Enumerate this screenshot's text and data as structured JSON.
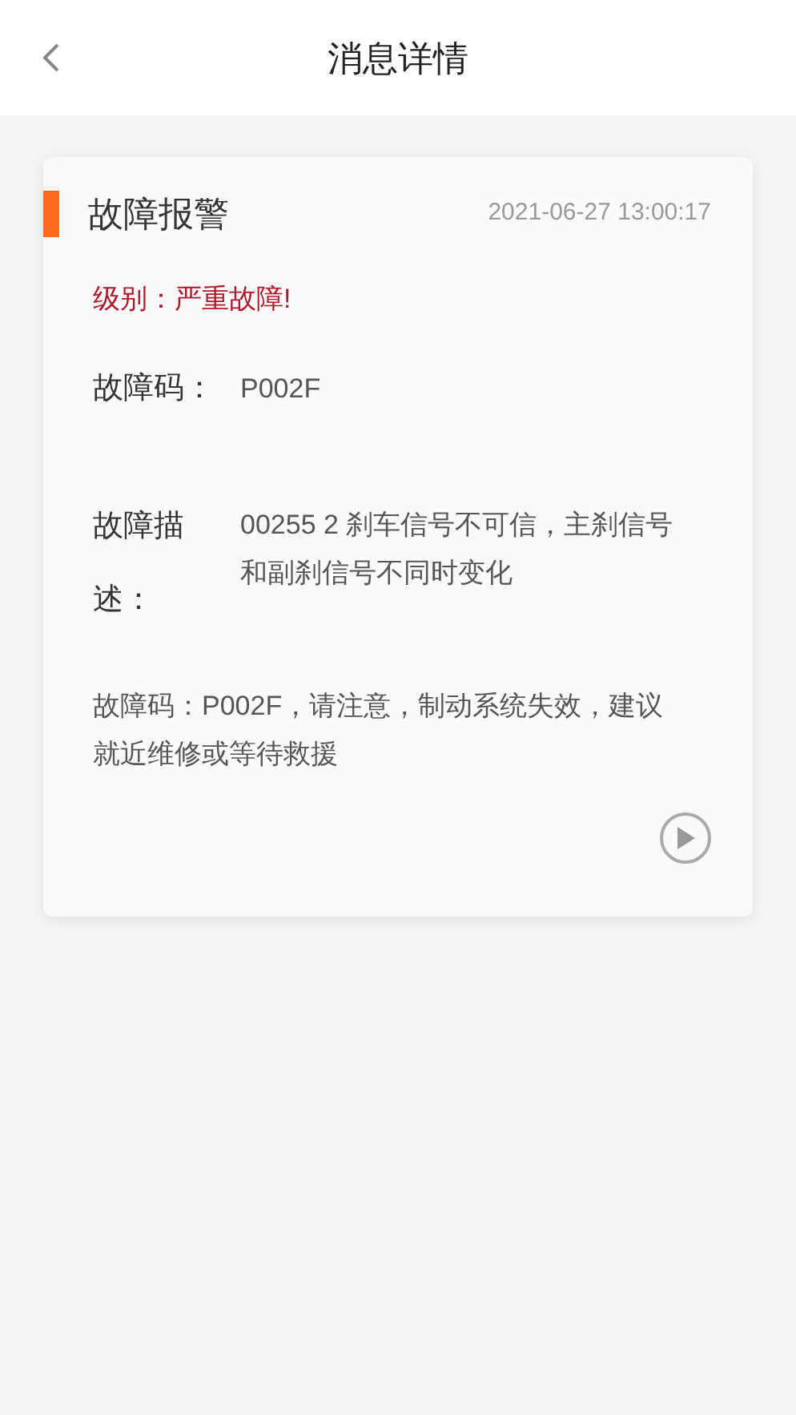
{
  "header": {
    "title": "消息详情"
  },
  "message": {
    "title": "故障报警",
    "time": "2021-06-27 13:00:17",
    "level": "级别：严重故障!",
    "fields": [
      {
        "label": "故障码：",
        "value": "P002F"
      },
      {
        "label": "故障描述：",
        "value": "00255 2 刹车信号不可信，主刹信号和副刹信号不同时变化"
      }
    ],
    "advice": "故障码：P002F，请注意，制动系统失效，建议就近维修或等待救援"
  }
}
